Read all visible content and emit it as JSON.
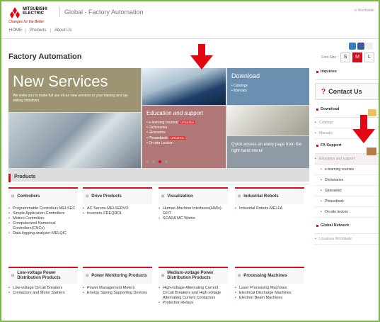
{
  "header": {
    "logo_name": "MITSUBISHI",
    "logo_name2": "ELECTRIC",
    "logo_tagline": "Changes for the Better",
    "site_name": "Global - Factory Automation",
    "worldwide": "Worldwide"
  },
  "topnav": [
    "HOME",
    "Products",
    "About Us"
  ],
  "font_size": {
    "label": "Font Size :",
    "options": [
      "S",
      "M",
      "L"
    ],
    "active": "M"
  },
  "page_title": "Factory Automation",
  "hero": {
    "new_services": {
      "title": "New Services",
      "desc": "We invite you to make full use of our new services in your training and up-skilling initiatives."
    },
    "download": {
      "title": "Download",
      "items": [
        "Catalogs",
        "Manuals"
      ]
    },
    "education": {
      "title": "Education and support",
      "items": [
        {
          "label": "e-learning courses",
          "badge": "UPDATED"
        },
        {
          "label": "Dictionaries",
          "badge": ""
        },
        {
          "label": "Glossaries",
          "badge": ""
        },
        {
          "label": "Phrasebook",
          "badge": "UPDATED"
        },
        {
          "label": "On-site Lexicon",
          "badge": ""
        }
      ]
    },
    "quick_access": "Quick access on every page from the right hand menu!"
  },
  "carousel": {
    "count": 4,
    "active_index": 2
  },
  "products": {
    "title": "Products",
    "categories": [
      {
        "title": "Controllers",
        "items": [
          "Programmable Controllers MELSEC",
          "Simple Application Controllers",
          "Motion Controllers",
          "Computerized Numerical Controllers(CNCs)",
          "Data logging analyzer-MELQIC"
        ]
      },
      {
        "title": "Drive Products",
        "items": [
          "AC Servos-MELSERVO",
          "Inverters-FREQROL"
        ]
      },
      {
        "title": "Visualization",
        "items": [
          "Human-Machine Interfaces(HMIs)-GOT",
          "SCADA MC Works"
        ]
      },
      {
        "title": "Industrial Robots",
        "items": [
          "Industrial Robots-MELFA"
        ]
      },
      {
        "title": "Low-voltage Power Distribution Products",
        "items": [
          "Low-voltage Circuit Breakers",
          "Contactors and Motor Starters"
        ]
      },
      {
        "title": "Power Monitoring Products",
        "items": [
          "Power Management Meters",
          "Energy Saving Supporting Devices"
        ]
      },
      {
        "title": "Medium-voltage Power Distribution Products",
        "items": [
          "High-voltage Alternating Current Circuit Breakers and High-voltage Alternating Current Contactors",
          "Protection Relays"
        ]
      },
      {
        "title": "Processing Machines",
        "items": [
          "Laser Processing Machines",
          "Electrical Discharge Machines",
          "Electron Beam Machines"
        ]
      }
    ]
  },
  "sidebar": {
    "inquiries": "Inquiries",
    "contact": "Contact Us",
    "download": {
      "title": "Download",
      "items": [
        "Catalogs",
        "Manuals"
      ]
    },
    "fa_support": {
      "title": "FA Support",
      "items": [
        "Education and support",
        "e-learning courses",
        "Dictionaries",
        "Glossaries",
        "Phrasebook",
        "On-site lexicon"
      ]
    },
    "global_network": {
      "title": "Global Network",
      "items": [
        "Locations Worldwide"
      ]
    }
  },
  "colors": {
    "accent": "#d0101e",
    "frame": "#7ab648",
    "arrow": "#e30613"
  }
}
